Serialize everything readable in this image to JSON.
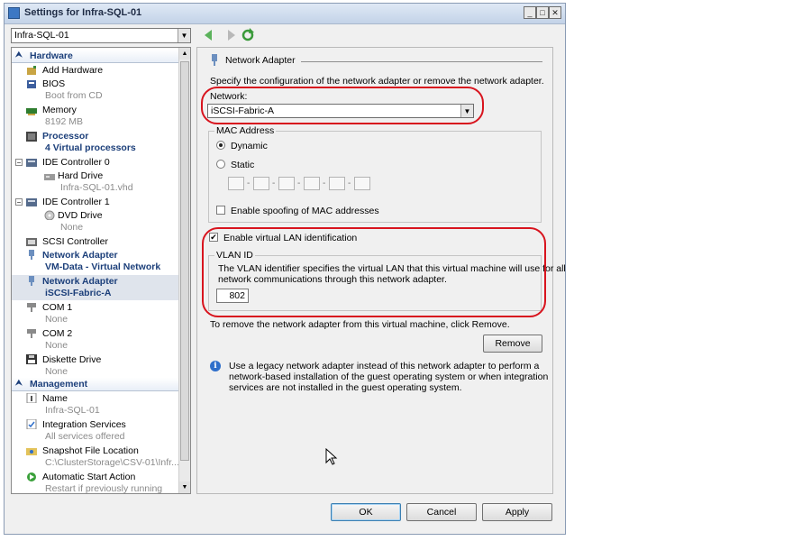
{
  "window": {
    "title": "Settings for Infra-SQL-01"
  },
  "vm_selector": {
    "value": "Infra-SQL-01"
  },
  "tree": {
    "hardware_label": "Hardware",
    "management_label": "Management",
    "items": [
      {
        "label": "Add Hardware",
        "sub": ""
      },
      {
        "label": "BIOS",
        "sub": "Boot from CD"
      },
      {
        "label": "Memory",
        "sub": "8192 MB"
      },
      {
        "label": "Processor",
        "sub": "4 Virtual processors"
      },
      {
        "label": "IDE Controller 0",
        "sub": ""
      },
      {
        "label": "Hard Drive",
        "sub": "Infra-SQL-01.vhd"
      },
      {
        "label": "IDE Controller 1",
        "sub": ""
      },
      {
        "label": "DVD Drive",
        "sub": "None"
      },
      {
        "label": "SCSI Controller",
        "sub": ""
      },
      {
        "label": "Network Adapter",
        "sub": "VM-Data - Virtual Network"
      },
      {
        "label": "Network Adapter",
        "sub": "iSCSI-Fabric-A"
      },
      {
        "label": "COM 1",
        "sub": "None"
      },
      {
        "label": "COM 2",
        "sub": "None"
      },
      {
        "label": "Diskette Drive",
        "sub": "None"
      }
    ],
    "mgmt_items": [
      {
        "label": "Name",
        "sub": "Infra-SQL-01"
      },
      {
        "label": "Integration Services",
        "sub": "All services offered"
      },
      {
        "label": "Snapshot File Location",
        "sub": "C:\\ClusterStorage\\CSV-01\\Infr..."
      },
      {
        "label": "Automatic Start Action",
        "sub": "Restart if previously running"
      }
    ]
  },
  "pane": {
    "section_title": "Network Adapter",
    "description": "Specify the configuration of the network adapter or remove the network adapter.",
    "network_label": "Network:",
    "network_value": "iSCSI-Fabric-A",
    "mac_group": "MAC Address",
    "mac_dynamic": "Dynamic",
    "mac_static": "Static",
    "mac_spoofing": "Enable spoofing of MAC addresses",
    "vlan_enable": "Enable virtual LAN identification",
    "vlan_group": "VLAN ID",
    "vlan_desc_1": "The VLAN identifier specifies the virtual LAN that this virtual machine will use for all",
    "vlan_desc_2": "network communications through this network adapter.",
    "vlan_value": "802",
    "remove_hint": "To remove the network adapter from this virtual machine, click Remove.",
    "remove_button": "Remove",
    "legacy_1": "Use a legacy network adapter instead of this network adapter to perform a",
    "legacy_2": "network-based installation of the guest operating system or when integration",
    "legacy_3": "services are not installed in the guest operating system."
  },
  "buttons": {
    "ok": "OK",
    "cancel": "Cancel",
    "apply": "Apply"
  },
  "colors": {
    "highlight_annotation": "#d8141e",
    "category_text": "#1c3f7a",
    "selected_row": "#dfe4ec"
  }
}
